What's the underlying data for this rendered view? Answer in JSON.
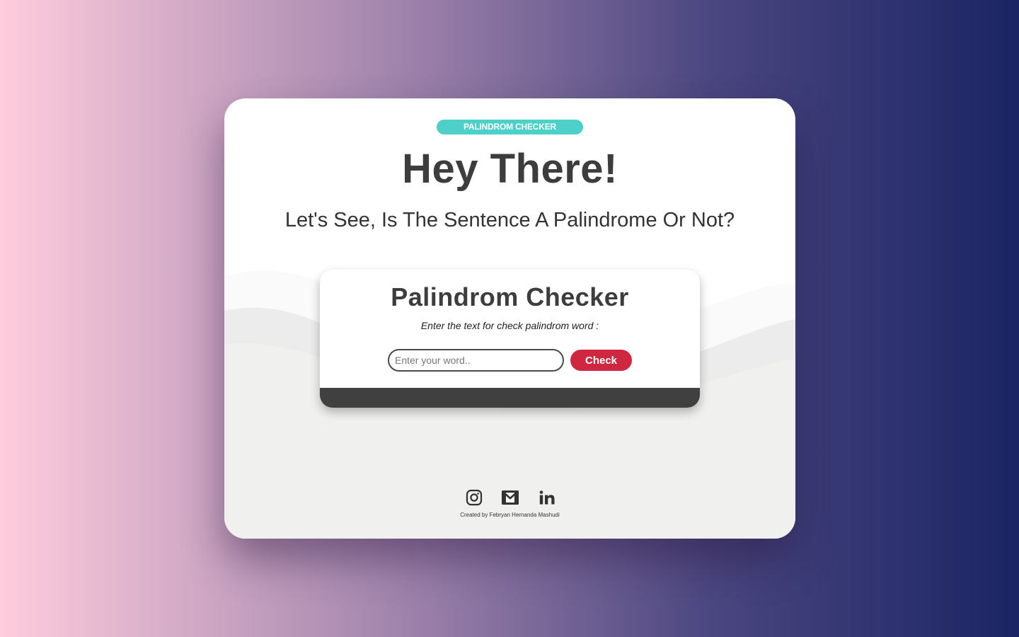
{
  "badge": {
    "label": "PALINDROM CHECKER"
  },
  "hero": {
    "title": "Hey There!",
    "subtitle": "Let's See, Is The Sentence A Palindrome Or Not?"
  },
  "checker": {
    "title": "Palindrom Checker",
    "instruction": "Enter the text for check palindrom word :",
    "input_value": "",
    "input_placeholder": "Enter your word..",
    "button_label": "Check",
    "result": ""
  },
  "socials": [
    {
      "icon": "instagram-icon"
    },
    {
      "icon": "mail-icon"
    },
    {
      "icon": "linkedin-icon"
    }
  ],
  "footer": {
    "credit": "Created by Febryan Hernanda Mashudi"
  },
  "colors": {
    "badge": "#4cd0c8",
    "button": "#d02740",
    "text_dark": "#3d3d3d",
    "result_bar": "#404040"
  }
}
